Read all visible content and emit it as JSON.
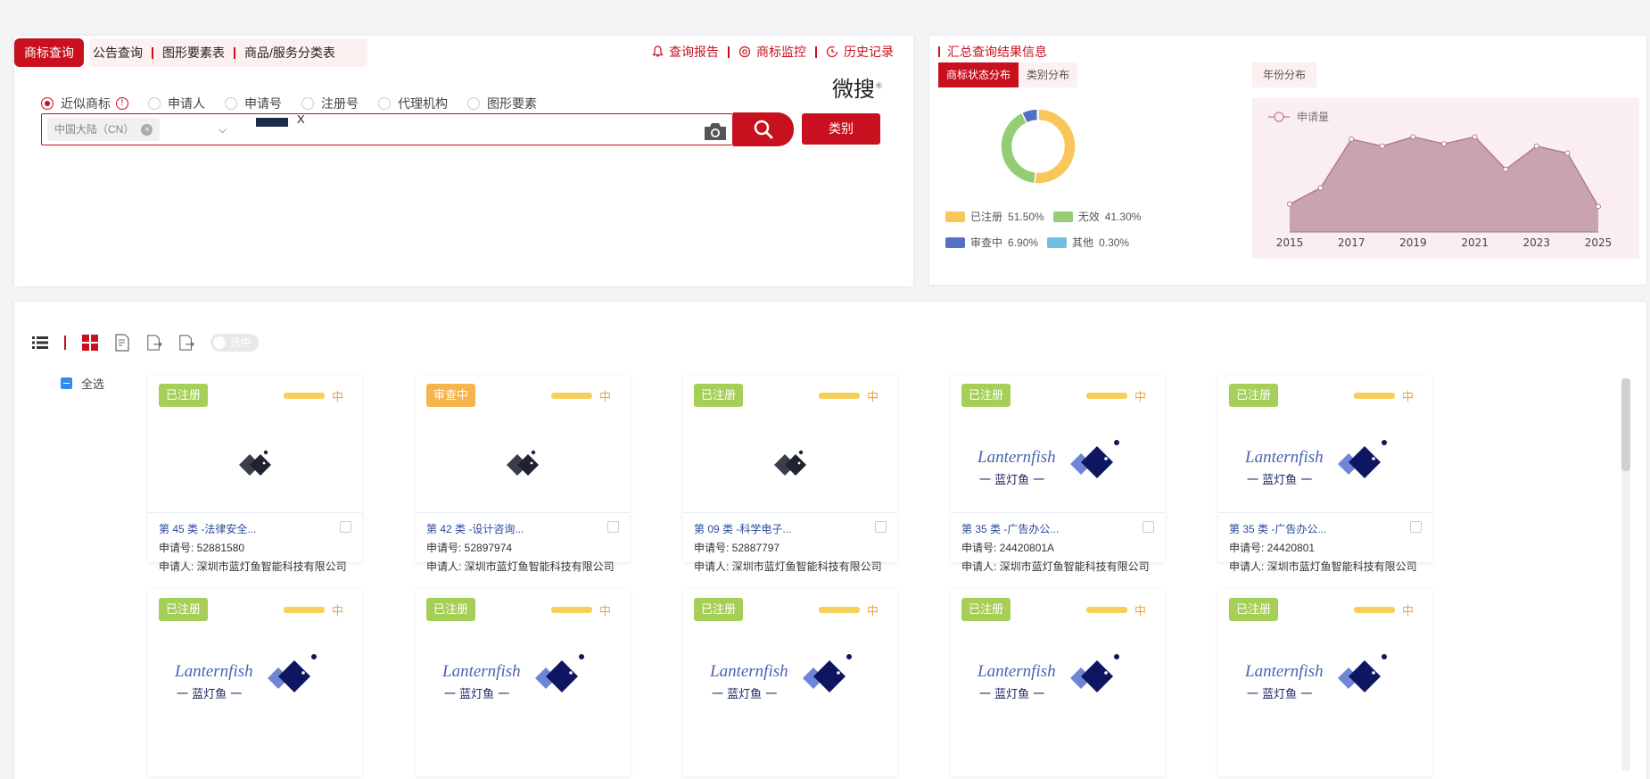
{
  "search": {
    "tabs": [
      {
        "label": "商标查询"
      },
      {
        "label": "公告查询"
      },
      {
        "label": "图形要素表"
      },
      {
        "label": "商品/服务分类表"
      }
    ],
    "top_links": [
      {
        "label": "查询报告",
        "icon": "bell-icon"
      },
      {
        "label": "商标监控",
        "icon": "monitor-icon"
      },
      {
        "label": "历史记录",
        "icon": "history-icon"
      }
    ],
    "brand": "微搜",
    "brand_mark": "®",
    "radios": [
      {
        "label": "近似商标",
        "selected": true
      },
      {
        "label": "申请人",
        "selected": false
      },
      {
        "label": "申请号",
        "selected": false
      },
      {
        "label": "注册号",
        "selected": false
      },
      {
        "label": "代理机构",
        "selected": false
      },
      {
        "label": "图形要素",
        "selected": false
      }
    ],
    "info_glyph": "!",
    "region": "中国大陆（CN）",
    "region_clear": "×",
    "dropdown_glyph": "⌵",
    "remove_image": "X",
    "category_button": "类别"
  },
  "summary": {
    "title": "汇总查询结果信息",
    "tabs": [
      {
        "label": "商标状态分布"
      },
      {
        "label": "类别分布"
      }
    ],
    "year_tab": "年份分布",
    "legend": [
      {
        "label": "已注册",
        "value": "51.50%",
        "color": "#f8c65a"
      },
      {
        "label": "无效",
        "value": "41.30%",
        "color": "#95cd74"
      },
      {
        "label": "审查中",
        "value": "6.90%",
        "color": "#5470c6"
      },
      {
        "label": "其他",
        "value": "0.30%",
        "color": "#6fbfe0"
      }
    ]
  },
  "chart_data": [
    {
      "type": "pie",
      "labels": [
        "已注册",
        "无效",
        "审查中",
        "其他"
      ],
      "values": [
        51.5,
        41.3,
        6.9,
        0.3
      ],
      "colors": [
        "#f8c65a",
        "#95cd74",
        "#5470c6",
        "#6fbfe0"
      ]
    },
    {
      "type": "area",
      "series": [
        {
          "name": "申请量",
          "values": [
            12,
            19,
            40,
            37,
            41,
            38,
            41,
            27,
            37,
            34,
            11
          ]
        }
      ],
      "x": [
        2015,
        2016,
        2017,
        2018,
        2019,
        2020,
        2021,
        2022,
        2023,
        2024,
        2025
      ],
      "tick_labels": [
        "2015",
        "2017",
        "2019",
        "2021",
        "2023",
        "2025"
      ],
      "ylim": [
        0,
        50
      ],
      "color": "#c9a4b0"
    }
  ],
  "results": {
    "toggle_label": "选中",
    "select_all": "全选",
    "cards": [
      {
        "status": "已注册",
        "status_type": "reg",
        "level": "中",
        "logo": "fish",
        "cls": "第 45 类 -法律安全...",
        "app_no": "申请号: 52881580",
        "applicant": "申请人: 深圳市蓝灯鱼智能科技有限公司"
      },
      {
        "status": "审查中",
        "status_type": "pending",
        "level": "中",
        "logo": "fish",
        "cls": "第 42 类 -设计咨询...",
        "app_no": "申请号: 52897974",
        "applicant": "申请人: 深圳市蓝灯鱼智能科技有限公司"
      },
      {
        "status": "已注册",
        "status_type": "reg",
        "level": "中",
        "logo": "fish",
        "cls": "第 09 类 -科学电子...",
        "app_no": "申请号: 52887797",
        "applicant": "申请人: 深圳市蓝灯鱼智能科技有限公司"
      },
      {
        "status": "已注册",
        "status_type": "reg",
        "level": "中",
        "logo": "lantern",
        "cls": "第 35 类 -广告办公...",
        "app_no": "申请号: 24420801A",
        "applicant": "申请人: 深圳市蓝灯鱼智能科技有限公司"
      },
      {
        "status": "已注册",
        "status_type": "reg",
        "level": "中",
        "logo": "lantern",
        "cls": "第 35 类 -广告办公...",
        "app_no": "申请号: 24420801",
        "applicant": "申请人: 深圳市蓝灯鱼智能科技有限公司"
      },
      {
        "status": "已注册",
        "status_type": "reg",
        "level": "中",
        "logo": "lantern"
      },
      {
        "status": "已注册",
        "status_type": "reg",
        "level": "中",
        "logo": "lantern"
      },
      {
        "status": "已注册",
        "status_type": "reg",
        "level": "中",
        "logo": "lantern"
      },
      {
        "status": "已注册",
        "status_type": "reg",
        "level": "中",
        "logo": "lantern"
      },
      {
        "status": "已注册",
        "status_type": "reg",
        "level": "中",
        "logo": "lantern"
      }
    ],
    "logo_text": {
      "en": "Lanternfish",
      "cn": "一  蓝灯鱼  一"
    }
  }
}
